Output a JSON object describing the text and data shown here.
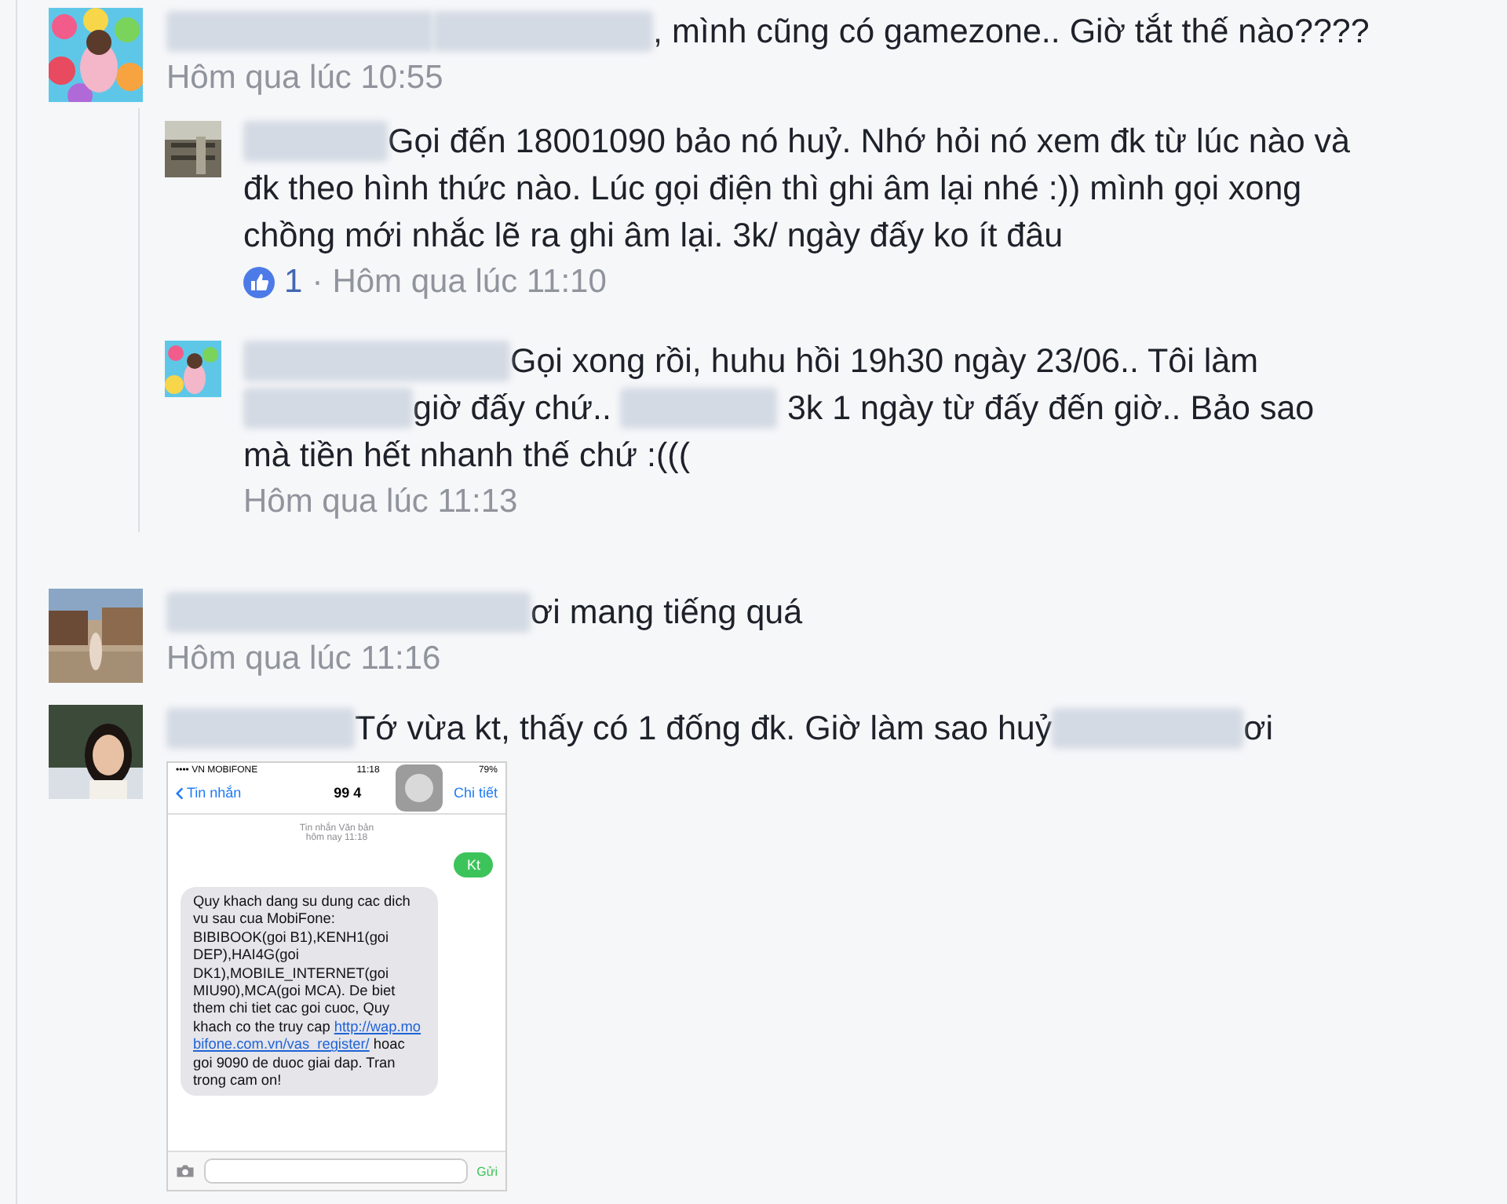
{
  "comments": [
    {
      "parts": [
        {
          "kind": "redacted"
        },
        {
          "kind": "redacted"
        },
        {
          "kind": "text",
          "text": ", mình cũng có gamezone.. Giờ tắt thế nào????"
        }
      ],
      "time": "Hôm qua lúc 10:55",
      "replies": [
        {
          "parts": [
            {
              "kind": "redacted"
            },
            {
              "kind": "text",
              "text": "Gọi đến 18001090 bảo nó huỷ. Nhớ hỏi nó xem đk từ lúc nào và đk theo hình thức nào. Lúc gọi điện thì ghi âm lại nhé :)) mình gọi xong chồng mới nhắc lẽ ra ghi âm lại. 3k/ ngày đấy ko ít đâu"
            }
          ],
          "likes": "1",
          "separator": "·",
          "time": "Hôm qua lúc 11:10"
        },
        {
          "parts": [
            {
              "kind": "redacted"
            },
            {
              "kind": "text",
              "text": "Gọi xong rồi, huhu hồi 19h30 ngày 23/06.. Tôi làm "
            },
            {
              "kind": "redacted"
            },
            {
              "kind": "text",
              "text": "giờ đấy chứ.. "
            },
            {
              "kind": "redacted"
            },
            {
              "kind": "text",
              "text": " 3k 1 ngày từ đấy đến giờ.. Bảo sao mà tiền hết nhanh thế chứ :((("
            }
          ],
          "time": "Hôm qua lúc 11:13"
        }
      ]
    },
    {
      "parts": [
        {
          "kind": "redacted"
        },
        {
          "kind": "text",
          "text": "ơi mang tiếng quá"
        }
      ],
      "time": "Hôm qua lúc 11:16"
    },
    {
      "parts": [
        {
          "kind": "redacted"
        },
        {
          "kind": "text",
          "text": "Tớ vừa kt, thấy có 1 đống đk. Giờ làm sao huỷ"
        },
        {
          "kind": "redacted"
        },
        {
          "kind": "text",
          "text": "ơi"
        }
      ],
      "attachment": {
        "carrier": "•••• VN MOBIFONE",
        "clock": "11:18",
        "battery": "79%",
        "back": "Tin nhắn",
        "title": "99 4",
        "details": "Chi tiết",
        "thread_label": "Tin nhắn Văn bản",
        "thread_date": "hôm nay 11:18",
        "sent": "Kt",
        "received": [
          {
            "kind": "text",
            "text": "Quy khach dang su dung cac dich vu sau cua MobiFone: BIBIBOOK(goi B1),KENH1(goi DEP),HAI4G(goi DK1),MOBILE_INTERNET(goi MIU90),MCA(goi MCA). De biet them chi tiet cac goi cuoc, Quy khach co the truy cap "
          },
          {
            "kind": "link",
            "text": "http://wap.mobifone.com.vn/vas_register/"
          },
          {
            "kind": "text",
            "text": " hoac goi 9090 de duoc giai dap. Tran trong cam on!"
          }
        ],
        "send": "Gửi"
      }
    }
  ]
}
